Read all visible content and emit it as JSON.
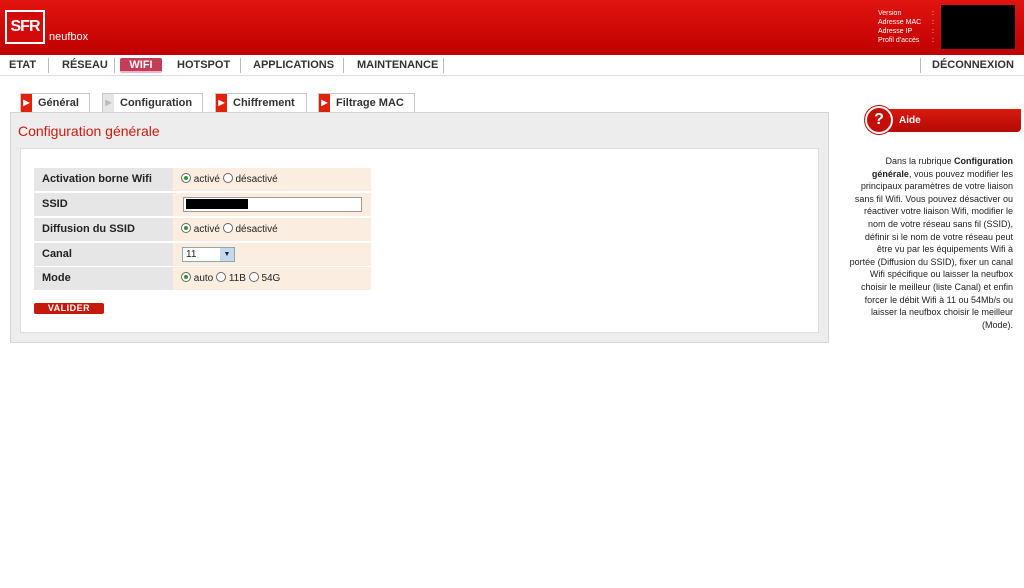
{
  "header": {
    "logo_text": "SFR",
    "brand": "neufbox",
    "info_labels": [
      "Version",
      "Adresse MAC",
      "Adresse IP",
      "Profil d'accès"
    ]
  },
  "nav": {
    "items": [
      "ETAT",
      "RÉSEAU",
      "WIFI",
      "HOTSPOT",
      "APPLICATIONS",
      "MAINTENANCE"
    ],
    "active": "WIFI",
    "logout": "DÉCONNEXION"
  },
  "tabs": [
    {
      "label": "Général",
      "active": false
    },
    {
      "label": "Configuration",
      "active": true
    },
    {
      "label": "Chiffrement",
      "active": false
    },
    {
      "label": "Filtrage MAC",
      "active": false
    }
  ],
  "section_title": "Configuration générale",
  "form": {
    "activation": {
      "label": "Activation borne Wifi",
      "options": [
        "activé",
        "désactivé"
      ],
      "selected": "activé"
    },
    "ssid": {
      "label": "SSID",
      "value": ""
    },
    "diffusion": {
      "label": "Diffusion du SSID",
      "options": [
        "activé",
        "désactivé"
      ],
      "selected": "activé"
    },
    "canal": {
      "label": "Canal",
      "value": "11"
    },
    "mode": {
      "label": "Mode",
      "options": [
        "auto",
        "11B",
        "54G"
      ],
      "selected": "auto"
    },
    "submit": "VALIDER"
  },
  "help": {
    "title": "Aide",
    "text_lead": "Dans la rubrique ",
    "text_bold": "Configuration générale",
    "text_rest": ", vous pouvez modifier les principaux paramètres de votre liaison sans fil Wifi. Vous pouvez désactiver ou réactiver votre liaison Wifi, modifier le nom de votre réseau sans fil (SSID), définir si le nom de votre réseau peut être vu par les équipements Wifi à portée (Diffusion du SSID), fixer un canal Wifi spécifique ou laisser la neufbox choisir le meilleur (liste Canal) et enfin forcer le débit Wifi à 11 ou 54Mb/s ou laisser la neufbox choisir le meilleur (Mode)."
  },
  "colors": {
    "brand_red": "#d0190b",
    "tab_active": "#c43c56",
    "radio_checked": "#2a9a2a"
  }
}
